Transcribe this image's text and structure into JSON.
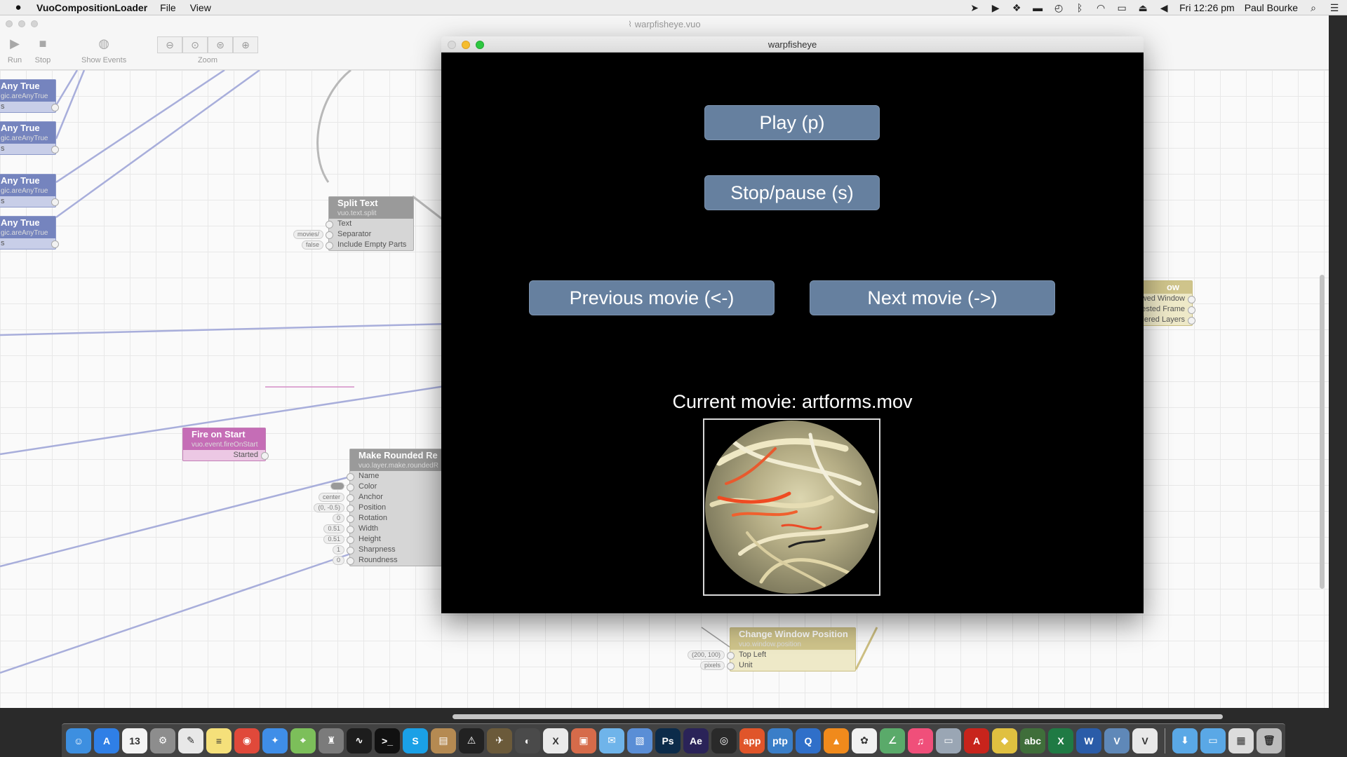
{
  "menubar": {
    "apple_icon": "apple-icon",
    "app_name": "VuoCompositionLoader",
    "menus": [
      "File",
      "View"
    ],
    "clock": "Fri 12:26 pm",
    "user": "Paul Bourke",
    "status_icons": [
      "location-icon",
      "play-circle-icon",
      "dropbox-icon",
      "drive-icon",
      "time-machine-icon",
      "bluetooth-icon",
      "wifi-icon",
      "airplay-icon",
      "eject-icon",
      "volume-icon"
    ]
  },
  "editor": {
    "title": "warpfisheye.vuo",
    "toolbar": {
      "run_label": "Run",
      "stop_label": "Stop",
      "show_events_label": "Show Events",
      "zoom_label": "Zoom",
      "zoom_buttons": [
        "zoom-out-icon",
        "zoom-actual-icon",
        "zoom-fit-icon",
        "zoom-in-icon"
      ]
    },
    "nodes": {
      "any_true": [
        {
          "title": "Any True",
          "cls": "gic.areAnyTrue",
          "port": "s"
        },
        {
          "title": "Any True",
          "cls": "gic.areAnyTrue",
          "port": "s"
        },
        {
          "title": "Any True",
          "cls": "gic.areAnyTrue",
          "port": "s"
        },
        {
          "title": "Any True",
          "cls": "gic.areAnyTrue",
          "port": "s"
        }
      ],
      "split_text": {
        "title": "Split Text",
        "cls": "vuo.text.split",
        "ports": [
          "Text",
          "Separator",
          "Include Empty Parts"
        ],
        "consts": {
          "separator": "movies/",
          "include_empty": "false"
        }
      },
      "fire_on_start": {
        "title": "Fire on Start",
        "cls": "vuo.event.fireOnStart",
        "port": "Started"
      },
      "make_rounded": {
        "title": "Make Rounded Re",
        "cls": "vuo.layer.make.roundedR",
        "ports": [
          "Name",
          "Color",
          "Anchor",
          "Position",
          "Rotation",
          "Width",
          "Height",
          "Sharpness",
          "Roundness"
        ],
        "consts": {
          "anchor": "center",
          "position": "(0, -0.5)",
          "rotation": "0",
          "width": "0.51",
          "height": "0.51",
          "sharpness": "1",
          "roundness": "0"
        }
      },
      "window": {
        "title": "ow",
        "ports": [
          "ewed Window",
          "ested Frame",
          "dered Layers"
        ]
      },
      "change_window_position": {
        "title": "Change Window Position",
        "cls": "vuo.window.position",
        "ports": [
          "Top Left",
          "Unit"
        ],
        "consts": {
          "top_left": "(200, 100)",
          "unit": "pixels"
        }
      }
    }
  },
  "warp_window": {
    "title": "warpfisheye",
    "buttons": {
      "play": "Play (p)",
      "stop": "Stop/pause (s)",
      "previous": "Previous movie (<-)",
      "next": "Next movie (->)"
    },
    "current_movie": "Current movie: artforms.mov"
  },
  "dock": {
    "items": [
      {
        "name": "finder-icon",
        "color": "#3d8fe0",
        "glyph": "☺"
      },
      {
        "name": "app-store-icon",
        "color": "#2f7fe6",
        "glyph": "A"
      },
      {
        "name": "calendar-icon",
        "color": "#f4f4f4",
        "glyph": "13"
      },
      {
        "name": "system-preferences-icon",
        "color": "#8d8d8d",
        "glyph": "⚙"
      },
      {
        "name": "textedit-icon",
        "color": "#e8e8e8",
        "glyph": "✎"
      },
      {
        "name": "notes-icon",
        "color": "#f5e07a",
        "glyph": "≡"
      },
      {
        "name": "chrome-icon",
        "color": "#e0493a",
        "glyph": "◉"
      },
      {
        "name": "safari-icon",
        "color": "#3f8ee8",
        "glyph": "✦"
      },
      {
        "name": "maps-icon",
        "color": "#7cbf5a",
        "glyph": "⌖"
      },
      {
        "name": "automator-icon",
        "color": "#7b7b7b",
        "glyph": "♜"
      },
      {
        "name": "activity-monitor-icon",
        "color": "#1d1d1d",
        "glyph": "∿"
      },
      {
        "name": "terminal-icon",
        "color": "#111111",
        "glyph": ">_"
      },
      {
        "name": "skype-icon",
        "color": "#1aa0e6",
        "glyph": "S"
      },
      {
        "name": "archive-icon",
        "color": "#b58a52",
        "glyph": "▤"
      },
      {
        "name": "console-icon",
        "color": "#222222",
        "glyph": "⚠"
      },
      {
        "name": "xcode-helper-icon",
        "color": "#6b5a3a",
        "glyph": "✈"
      },
      {
        "name": "pro-app-icon",
        "color": "#4a4a4a",
        "glyph": "◐"
      },
      {
        "name": "x11-icon",
        "color": "#eaeaea",
        "glyph": "X"
      },
      {
        "name": "photo-app-icon",
        "color": "#d66b4a",
        "glyph": "▣"
      },
      {
        "name": "mail-icon",
        "color": "#6fb4ea",
        "glyph": "✉"
      },
      {
        "name": "preview-icon",
        "color": "#5a8ed6",
        "glyph": "▧"
      },
      {
        "name": "photoshop-icon",
        "color": "#0c2b4a",
        "glyph": "Ps"
      },
      {
        "name": "after-effects-icon",
        "color": "#2a2358",
        "glyph": "Ae"
      },
      {
        "name": "eye-app-icon",
        "color": "#2a2a2a",
        "glyph": "◎"
      },
      {
        "name": "app-icon",
        "color": "#e0552a",
        "glyph": "app"
      },
      {
        "name": "ptp-icon",
        "color": "#3a7ec8",
        "glyph": "ptp"
      },
      {
        "name": "quicktime-icon",
        "color": "#2f6fc9",
        "glyph": "Q"
      },
      {
        "name": "vlc-icon",
        "color": "#f08a1c",
        "glyph": "▲"
      },
      {
        "name": "photos-icon",
        "color": "#f1f1f1",
        "glyph": "✿"
      },
      {
        "name": "grapher-icon",
        "color": "#5aaa6a",
        "glyph": "∠"
      },
      {
        "name": "itunes-icon",
        "color": "#f04f7a",
        "glyph": "♫"
      },
      {
        "name": "image-capture-icon",
        "color": "#9aa6b4",
        "glyph": "▭"
      },
      {
        "name": "acrobat-icon",
        "color": "#c8241c",
        "glyph": "A"
      },
      {
        "name": "color-picker-icon",
        "color": "#e0c040",
        "glyph": "◆"
      },
      {
        "name": "chalkboard-icon",
        "color": "#3f6e3a",
        "glyph": "abc"
      },
      {
        "name": "excel-icon",
        "color": "#1f7a44",
        "glyph": "X"
      },
      {
        "name": "word-icon",
        "color": "#2a5ca8",
        "glyph": "W"
      },
      {
        "name": "vuo-icon",
        "color": "#5f88b8",
        "glyph": "V"
      },
      {
        "name": "vuo-doc-icon",
        "color": "#e8e8e8",
        "glyph": "V"
      }
    ],
    "right_items": [
      {
        "name": "downloads-folder-icon",
        "color": "#5aa8e6",
        "glyph": "⬇"
      },
      {
        "name": "documents-folder-icon",
        "color": "#5aa8e6",
        "glyph": "▭"
      },
      {
        "name": "screenshot-icon",
        "color": "#dcdcdc",
        "glyph": "▦"
      },
      {
        "name": "trash-icon",
        "color": "#bcbcbc",
        "glyph": "🗑"
      }
    ]
  }
}
